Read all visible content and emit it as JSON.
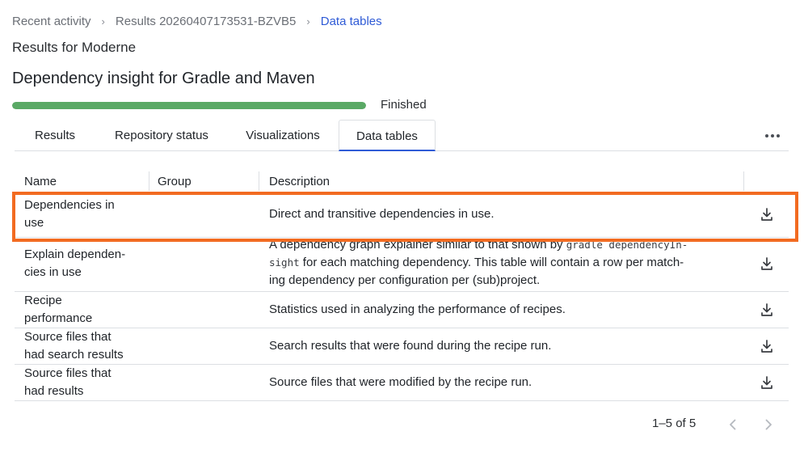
{
  "breadcrumb": {
    "items": [
      "Recent activity",
      "Results 20260407173531-BZVB5",
      "Data tables"
    ]
  },
  "header": {
    "results_for": "Results for Moderne",
    "title": "Dependency insight for Gradle and Maven"
  },
  "progress": {
    "percent": 100,
    "status": "Finished",
    "color": "#5aa965"
  },
  "tabs": [
    {
      "label": "Results"
    },
    {
      "label": "Repository status"
    },
    {
      "label": "Visualizations"
    },
    {
      "label": "Data tables",
      "active": true
    }
  ],
  "table": {
    "columns": [
      "Name",
      "Group",
      "Description"
    ],
    "rows": [
      {
        "name": [
          "Dependencies in",
          "use"
        ],
        "group": "",
        "description": [
          "Direct and transitive dependencies in use."
        ],
        "highlighted": true
      },
      {
        "name": [
          "Explain dependen-",
          "cies in use"
        ],
        "group": "",
        "description_parts": {
          "line1_text": "A dependency graph explainer similar to that shown by ",
          "line1_code": "gradle dependencyIn-",
          "line2_code": "sight",
          "line2_text": " for each matching dependency. This table will contain a row per match-",
          "line3_text": "ing dependency per configuration per (sub)project."
        }
      },
      {
        "name": [
          "Recipe",
          "performance"
        ],
        "group": "",
        "description": [
          "Statistics used in analyzing the performance of recipes."
        ]
      },
      {
        "name": [
          "Source files that",
          "had search results"
        ],
        "group": "",
        "description": [
          "Search results that were found during the recipe run."
        ]
      },
      {
        "name": [
          "Source files that",
          "had results"
        ],
        "group": "",
        "description": [
          "Source files that were modified by the recipe run."
        ]
      }
    ],
    "download_icon": "download-icon"
  },
  "pagination": {
    "range": "1–5 of 5"
  },
  "colors": {
    "accent": "#2f5bd6",
    "highlight": "#f26b21"
  }
}
